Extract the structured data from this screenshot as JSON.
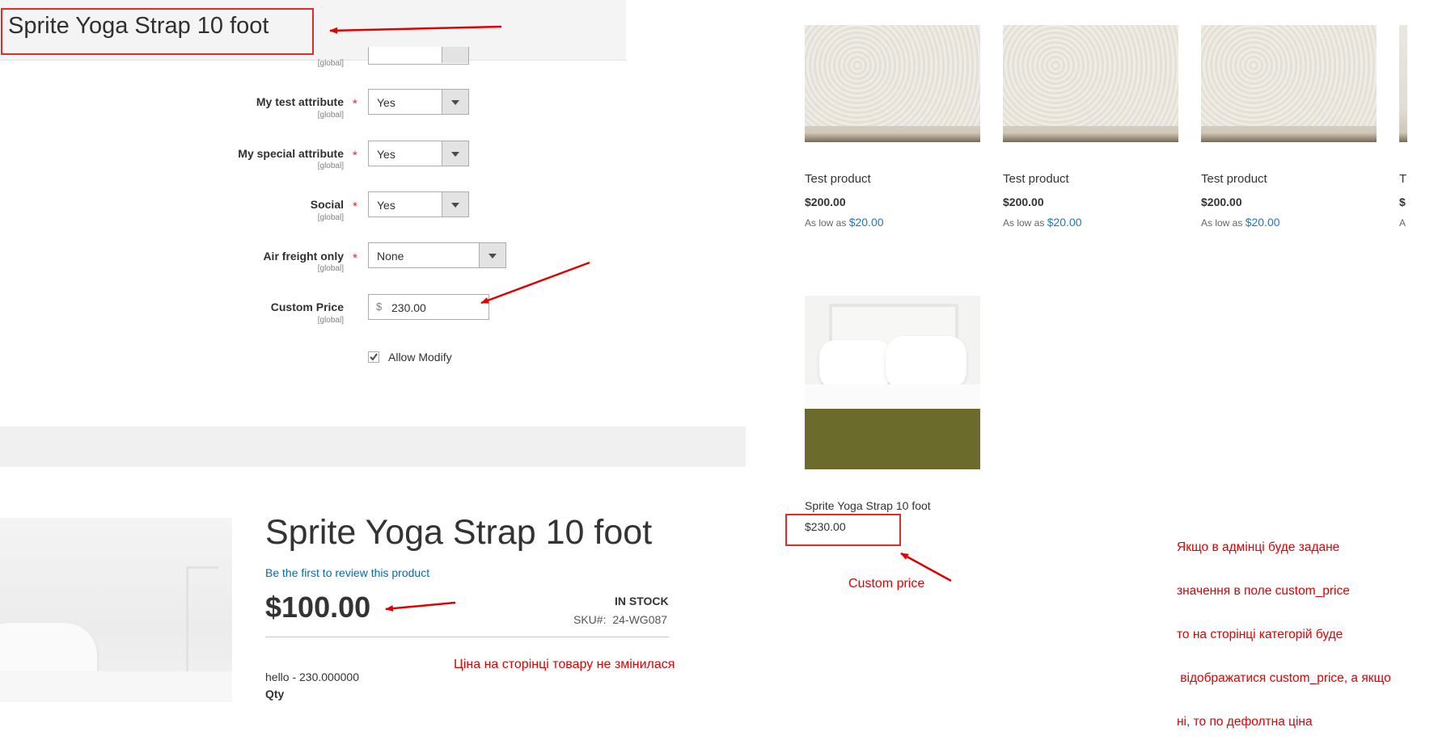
{
  "admin": {
    "title": "Sprite Yoga Strap 10 foot",
    "scope_label": "[global]",
    "rows": [
      {
        "label": "My test attribute",
        "value": "Yes"
      },
      {
        "label": "My special attribute",
        "value": "Yes"
      },
      {
        "label": "Social",
        "value": "Yes"
      },
      {
        "label": "Air freight only",
        "value": "None"
      }
    ],
    "custom_price": {
      "label": "Custom Price",
      "currency": "$",
      "value": "230.00"
    },
    "allow_modify": {
      "label": "Allow Modify",
      "checked": true
    },
    "required_mark": "*"
  },
  "product_page": {
    "title": "Sprite Yoga Strap 10 foot",
    "review_link": "Be the first to review this product",
    "price": "$100.00",
    "stock": "IN STOCK",
    "sku_label": "SKU#:",
    "sku_value": "24-WG087",
    "custom_line": "hello - 230.000000",
    "qty_label": "Qty"
  },
  "category": {
    "products": [
      {
        "name": "Test product",
        "price": "$200.00",
        "as_low_as": "As low as",
        "low_price": "$20.00"
      },
      {
        "name": "Test product",
        "price": "$200.00",
        "as_low_as": "As low as",
        "low_price": "$20.00"
      },
      {
        "name": "Test product",
        "price": "$200.00",
        "as_low_as": "As low as",
        "low_price": "$20.00"
      },
      {
        "name": "T",
        "price": "$",
        "as_low_as": "A"
      }
    ],
    "featured": {
      "name": "Sprite Yoga Strap 10 foot",
      "price": "$230.00"
    }
  },
  "annotations": {
    "product_page_note": "Ціна на сторінці товару не змінилася",
    "custom_price_note": "Custom price",
    "explanation": [
      "Якщо в адмінці буде задане",
      "значення в поле custom_price",
      "то на сторінці категорій буде",
      " відображатися custom_price, а якщо",
      "ні, то по дефолтна ціна"
    ]
  },
  "colors": {
    "annotation_red": "#e00000",
    "link_blue": "#006bb4",
    "accent_blue": "#1979c3"
  }
}
